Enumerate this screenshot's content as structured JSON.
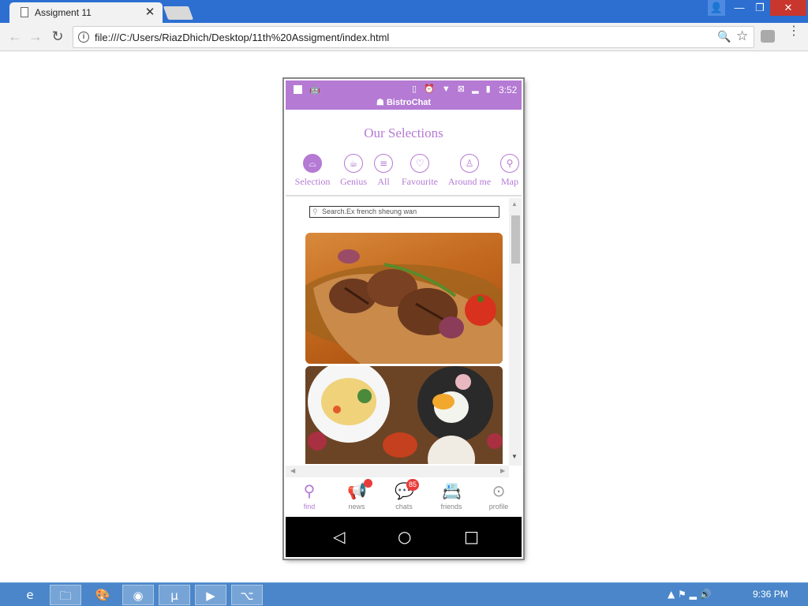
{
  "browser": {
    "tab_title": "Assigment 11",
    "tab_close": "✕",
    "url": "file:///C:/Users/RiazDhich/Desktop/11th%20Assigment/index.html",
    "back_icon": "←",
    "forward_icon": "→",
    "reload_icon": "↻",
    "zoom_icon": "🔍",
    "star_icon": "☆",
    "menu_icon": "⋮",
    "min_icon": "—",
    "max_icon": "❐",
    "close_icon": "✕",
    "user_icon": "👤"
  },
  "phone": {
    "status": {
      "time": "3:52",
      "icons": "▯ ⏰ ▼ ⊠ ▂ ▮"
    },
    "brand": "BistroChat",
    "title": "Our Selections",
    "categories": [
      {
        "label": "Selection",
        "icon": "⌓"
      },
      {
        "label": "Genius",
        "icon": "☕"
      },
      {
        "label": "All",
        "icon": "≡"
      },
      {
        "label": "Favourite",
        "icon": "♡"
      },
      {
        "label": "Around me",
        "icon": "♙"
      },
      {
        "label": "Map",
        "icon": "⚲"
      }
    ],
    "search_placeholder": "Search.Ex french sheung wan",
    "tabs": [
      {
        "label": "find",
        "icon": "⚲"
      },
      {
        "label": "news",
        "icon": "📢"
      },
      {
        "label": "chats",
        "icon": "💬",
        "badge": "85"
      },
      {
        "label": "friends",
        "icon": "📇"
      },
      {
        "label": "profile",
        "icon": "⊙"
      }
    ],
    "nav": {
      "back": "◁",
      "home": "○",
      "recent": "□"
    }
  },
  "taskbar": {
    "apps": [
      "e",
      "🗀",
      "🎨",
      "◉",
      "µ",
      "▶",
      "⌥"
    ],
    "clock": "9:36 PM",
    "tray": "▲ ⚑ ▂ 🔊"
  },
  "colors": {
    "accent": "#b57ad4",
    "badge": "#e93b3b"
  }
}
